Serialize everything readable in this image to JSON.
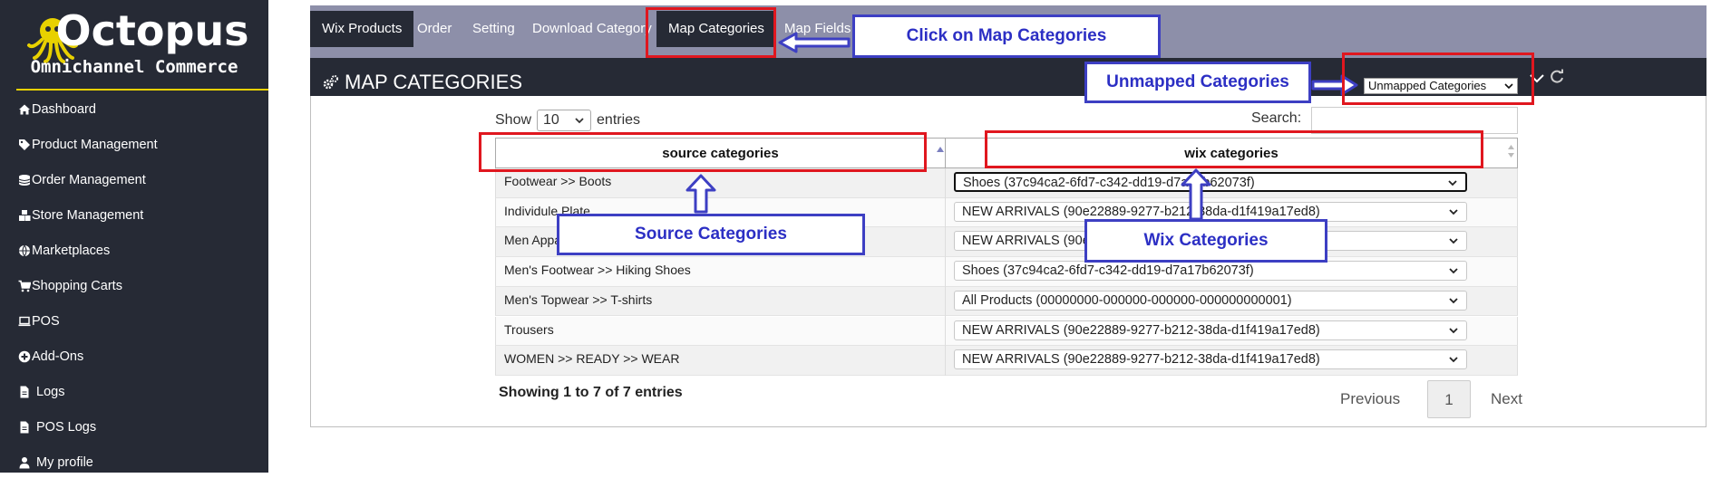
{
  "brand": {
    "title": "Octopus",
    "subtitle": "Omnichannel Commerce",
    "accent_color": "#e8d100"
  },
  "sidebar": {
    "items": [
      {
        "label": "Dashboard",
        "icon": "home-icon"
      },
      {
        "label": "Product Management",
        "icon": "tag-icon"
      },
      {
        "label": "Order Management",
        "icon": "database-icon"
      },
      {
        "label": "Store Management",
        "icon": "cubes-icon"
      },
      {
        "label": "Marketplaces",
        "icon": "globe-icon"
      },
      {
        "label": "Shopping Carts",
        "icon": "cart-icon"
      },
      {
        "label": "POS",
        "icon": "laptop-icon"
      },
      {
        "label": "Add-Ons",
        "icon": "plus-circle-icon"
      },
      {
        "label": "Logs",
        "icon": "file-icon"
      },
      {
        "label": "POS Logs",
        "icon": "file-icon"
      },
      {
        "label": "My profile",
        "icon": "user-icon"
      }
    ]
  },
  "tabs": [
    {
      "label": "Wix Products",
      "active": true
    },
    {
      "label": "Order",
      "active": false
    },
    {
      "label": "Setting",
      "active": false
    },
    {
      "label": "Download Category",
      "active": false
    },
    {
      "label": "Map Categories",
      "active": true
    },
    {
      "label": "Map Fields",
      "active": false
    }
  ],
  "page": {
    "title": "MAP CATEGORIES",
    "filter_value": "Unmapped Categories"
  },
  "table": {
    "show_label": "Show",
    "entries_value": "10",
    "entries_label": "entries",
    "search_label": "Search:",
    "search_value": "",
    "columns": [
      "source categories",
      "wix categories"
    ],
    "rows": [
      {
        "source": "Footwear >> Boots",
        "wix": "Shoes (37c94ca2-6fd7-c342-dd19-d7a17b62073f)"
      },
      {
        "source": "Individule Plate",
        "wix": "NEW ARRIVALS (90e22889-9277-b212-38da-d1f419a17ed8)"
      },
      {
        "source": "Men Apparel",
        "wix": "NEW ARRIVALS (90e22889-9277-b212-38da-d1f419a17ed8)"
      },
      {
        "source": "Men's Footwear >> Hiking Shoes",
        "wix": "Shoes (37c94ca2-6fd7-c342-dd19-d7a17b62073f)"
      },
      {
        "source": "Men's Topwear >> T-shirts",
        "wix": "All Products (00000000-000000-000000-000000000001)"
      },
      {
        "source": "Trousers",
        "wix": "NEW ARRIVALS (90e22889-9277-b212-38da-d1f419a17ed8)"
      },
      {
        "source": "WOMEN >> READY >> WEAR",
        "wix": "NEW ARRIVALS (90e22889-9277-b212-38da-d1f419a17ed8)"
      }
    ],
    "info": "Showing 1 to 7 of 7 entries",
    "prev_label": "Previous",
    "current_page": "1",
    "next_label": "Next"
  },
  "annotations": {
    "map_categories": "Click on Map Categories",
    "unmapped": "Unmapped Categories",
    "source": "Source Categories",
    "wix": "Wix Categories",
    "box_color": "#3d3fc3",
    "highlight_color": "#e0171f"
  }
}
